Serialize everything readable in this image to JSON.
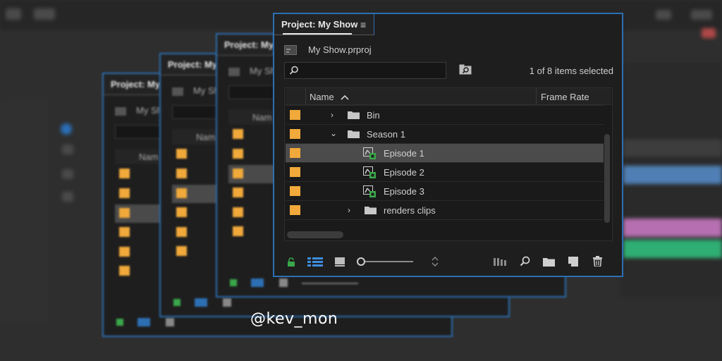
{
  "project": {
    "tab_title": "Project: My Show",
    "ghost_tab_title": "Project: My",
    "file_name": "My Show.prproj",
    "selection_status": "1 of 8 items selected",
    "search_placeholder": ""
  },
  "columns": {
    "name": "Name",
    "frame_rate": "Frame Rate"
  },
  "rows": [
    {
      "label": "Bin",
      "type": "bin",
      "expanded": false,
      "selected": false
    },
    {
      "label": "Season 1",
      "type": "bin",
      "expanded": true,
      "selected": false
    },
    {
      "label": "Episode 1",
      "type": "sequence",
      "selected": true
    },
    {
      "label": "Episode 2",
      "type": "sequence",
      "selected": false
    },
    {
      "label": "Episode 3",
      "type": "sequence",
      "selected": false
    },
    {
      "label": "renders clips",
      "type": "bin",
      "expanded": false,
      "selected": false
    }
  ],
  "ghost_panels": {
    "truncated_file": "My Sh",
    "truncated_column": "Nam"
  },
  "toolbar_icons": [
    "lock-icon",
    "list-view-icon",
    "icon-view-icon",
    "zoom-slider",
    "sort-icon",
    "automate-icon",
    "find-icon",
    "new-bin-icon",
    "new-item-icon",
    "trash-icon"
  ],
  "watermark": "@kev_mon",
  "colors": {
    "accent": "#2d6fb3",
    "label_orange": "#f0a93a",
    "lock_green": "#3aa84a",
    "panel_bg": "#1e1e1e"
  }
}
